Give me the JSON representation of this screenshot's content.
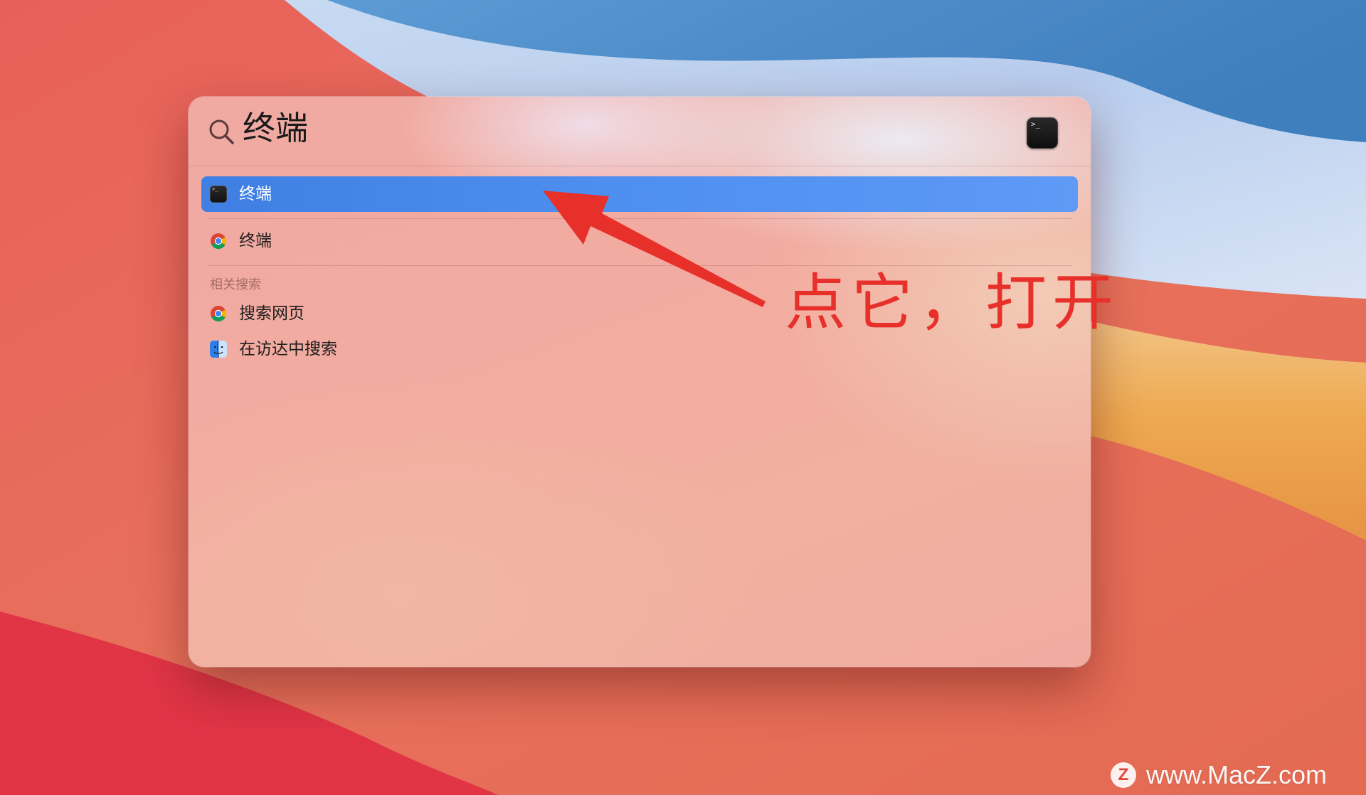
{
  "spotlight": {
    "query": "终端",
    "preview_icon": "terminal-icon",
    "results": [
      {
        "label": "终端",
        "icon": "terminal-icon",
        "selected": true
      },
      {
        "label": "终端",
        "icon": "chrome-icon",
        "selected": false
      }
    ],
    "related_section": {
      "header": "相关搜索",
      "items": [
        {
          "label": "搜索网页",
          "icon": "chrome-icon"
        },
        {
          "label": "在访达中搜索",
          "icon": "finder-icon"
        }
      ]
    }
  },
  "annotation": {
    "text": "点它，打开",
    "color": "#e8302a"
  },
  "watermark": {
    "logo_letter": "Z",
    "site": "www.MacZ.com"
  },
  "colors": {
    "selection": "#4a8aec",
    "annotation": "#e8302a"
  }
}
